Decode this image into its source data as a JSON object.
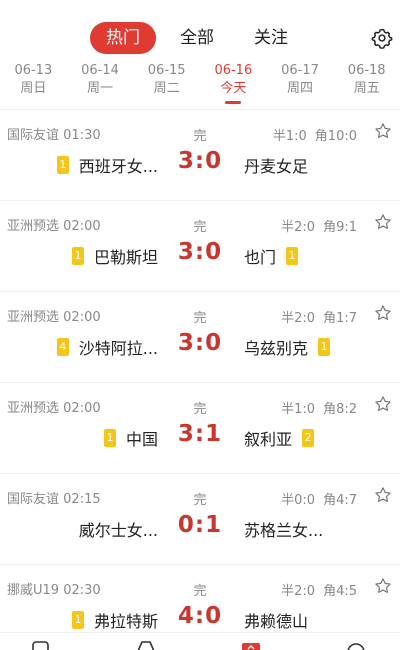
{
  "tabs": [
    "热门",
    "全部",
    "关注"
  ],
  "dates": [
    {
      "md": "06-13",
      "wd": "周日"
    },
    {
      "md": "06-14",
      "wd": "周一"
    },
    {
      "md": "06-15",
      "wd": "周二"
    },
    {
      "md": "06-16",
      "wd": "今天"
    },
    {
      "md": "06-17",
      "wd": "周四"
    },
    {
      "md": "06-18",
      "wd": "周五"
    }
  ],
  "matches": [
    {
      "league": "国际友谊",
      "time": "01:30",
      "status": "完",
      "half": "半1:0",
      "corner": "角10:0",
      "home": "西班牙女...",
      "home_badge": "1",
      "score": "3:0",
      "away": "丹麦女足",
      "away_badge": ""
    },
    {
      "league": "亚洲预选",
      "time": "02:00",
      "status": "完",
      "half": "半2:0",
      "corner": "角9:1",
      "home": "巴勒斯坦",
      "home_badge": "1",
      "score": "3:0",
      "away": "也门",
      "away_badge": "1"
    },
    {
      "league": "亚洲预选",
      "time": "02:00",
      "status": "完",
      "half": "半2:0",
      "corner": "角1:7",
      "home": "沙特阿拉...",
      "home_badge": "4",
      "score": "3:0",
      "away": "乌兹别克",
      "away_badge": "1"
    },
    {
      "league": "亚洲预选",
      "time": "02:00",
      "status": "完",
      "half": "半1:0",
      "corner": "角8:2",
      "home": "中国",
      "home_badge": "1",
      "score": "3:1",
      "away": "叙利亚",
      "away_badge": "2"
    },
    {
      "league": "国际友谊",
      "time": "02:15",
      "status": "完",
      "half": "半0:0",
      "corner": "角4:7",
      "home": "威尔士女...",
      "home_badge": "",
      "score": "0:1",
      "away": "苏格兰女...",
      "away_badge": ""
    },
    {
      "league": "挪威U19",
      "time": "02:30",
      "status": "完",
      "half": "半2:0",
      "corner": "角4:5",
      "home": "弗拉特斯",
      "home_badge": "1",
      "score": "4:0",
      "away": "弗赖德山",
      "away_badge": ""
    }
  ],
  "colors": {
    "accent": "#e03b32",
    "score": "#c8362e",
    "badge": "#f5c518"
  }
}
